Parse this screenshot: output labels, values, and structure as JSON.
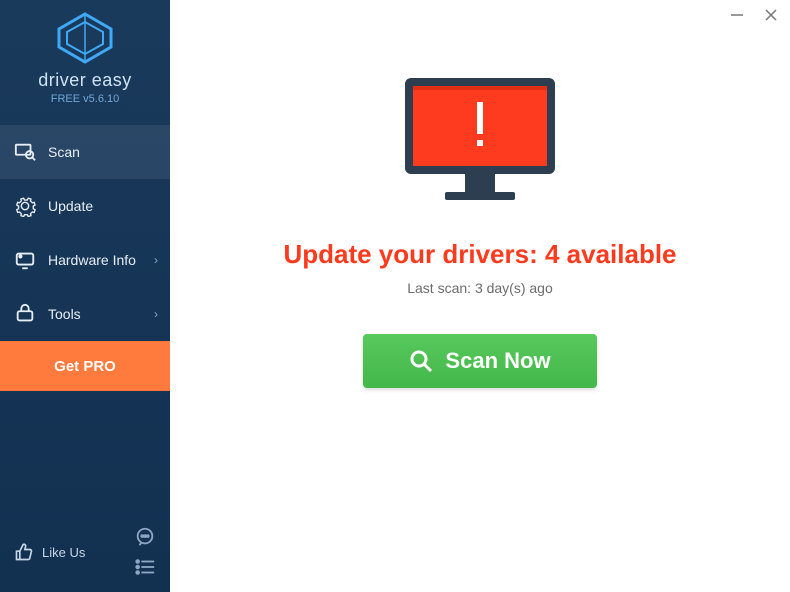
{
  "app": {
    "name": "driver easy",
    "version_label": "FREE v5.6.10"
  },
  "sidebar": {
    "items": [
      {
        "label": "Scan",
        "has_chevron": false
      },
      {
        "label": "Update",
        "has_chevron": false
      },
      {
        "label": "Hardware Info",
        "has_chevron": true
      },
      {
        "label": "Tools",
        "has_chevron": true
      }
    ],
    "get_pro_label": "Get PRO",
    "like_label": "Like Us"
  },
  "main": {
    "headline": "Update your drivers: 4 available",
    "last_scan": "Last scan: 3 day(s) ago",
    "scan_button": "Scan Now"
  }
}
